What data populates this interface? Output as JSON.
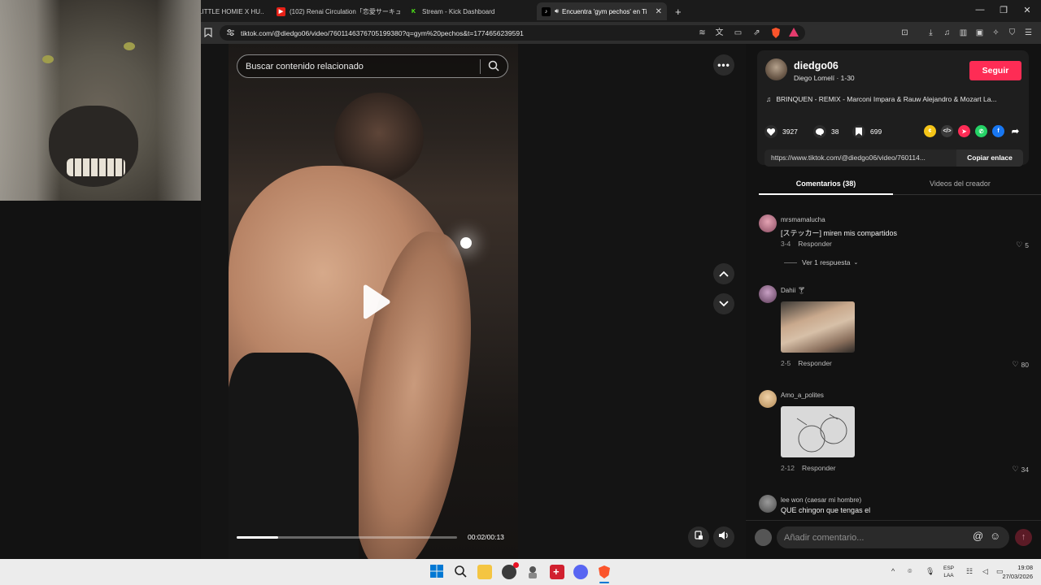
{
  "browser": {
    "tabs": [
      {
        "label": "LITTLE HOMIE X HU..",
        "icon": "spotify-icon"
      },
      {
        "label": "(102) Renai Circulation「恋愛サーキュレ",
        "icon": "youtube-icon"
      },
      {
        "label": "Stream - Kick Dashboard",
        "icon": "kick-icon"
      },
      {
        "label": "Encuentra 'gym pechos' en Ti",
        "icon": "tiktok-icon",
        "active": true
      }
    ],
    "new_tab": "+",
    "url": "tiktok.com/@diedgo06/video/7601146376705199380?q=gym%20pechos&t=1774656239591"
  },
  "video": {
    "search_placeholder": "Buscar contenido relacionado",
    "current_time": "00:02",
    "duration": "00:13",
    "time_display": "00:02/00:13",
    "progress": 0.19
  },
  "creator": {
    "username": "diedgo06",
    "subtitle": "Diego Lomelí · 1-30",
    "follow_label": "Seguir",
    "music": "BRINQUEN - REMIX - Marconi Impara & Rauw Alejandro & Mozart La..."
  },
  "stats": {
    "likes": "3927",
    "comments": "38",
    "saves": "699"
  },
  "share": {
    "link": "https://www.tiktok.com/@diedgo06/video/760114...",
    "copy_label": "Copiar enlace"
  },
  "panel_tabs": {
    "comments": "Comentarios (38)",
    "creator_videos": "Videos del creador"
  },
  "comments": [
    {
      "user": "mrsmamalucha",
      "text": "[ステッカー] miren mis compartidos",
      "date": "3-4",
      "reply": "Responder",
      "likes": "5",
      "view_replies": "Ver 1 respuesta"
    },
    {
      "user": "Dahii",
      "text": "",
      "date": "2-5",
      "reply": "Responder",
      "likes": "80"
    },
    {
      "user": "Amo_a_polites",
      "text": "",
      "date": "2-12",
      "reply": "Responder",
      "likes": "34"
    },
    {
      "user": "lee won (caesar mi hombre)",
      "text": "QUE chingon que tengas el"
    }
  ],
  "add_comment": {
    "placeholder": "Añadir comentario..."
  },
  "taskbar": {
    "lang_top": "ESP",
    "lang_bottom": "LAA",
    "time": "19:08",
    "date": "27/03/2026"
  },
  "colors": {
    "accent": "#fe2c55",
    "background": "#121212",
    "card": "#1e1e1e"
  }
}
